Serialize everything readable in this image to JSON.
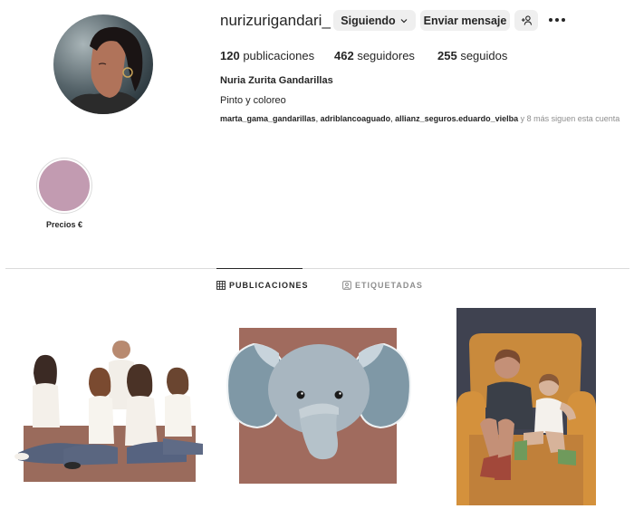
{
  "profile": {
    "username": "nurizurigandari_",
    "full_name": "Nuria Zurita Gandarillas",
    "bio": "Pinto y coloreo"
  },
  "actions": {
    "following_label": "Siguiendo",
    "message_label": "Enviar mensaje"
  },
  "stats": {
    "posts_count": "120",
    "posts_label": "publicaciones",
    "followers_count": "462",
    "followers_label": "seguidores",
    "following_count": "255",
    "following_label": "seguidos"
  },
  "followed_by": {
    "names": [
      "marta_gama_gandarillas",
      "adriblancoaguado",
      "allianz_seguros.eduardo_vielba"
    ],
    "separator": ", ",
    "more_text": " y 8 más siguen esta cuenta"
  },
  "highlights": [
    {
      "label": "Precios €",
      "color": "#c29bb1"
    }
  ],
  "tabs": [
    {
      "label": "PUBLICACIONES",
      "icon": "grid-icon",
      "active": true
    },
    {
      "label": "ETIQUETADAS",
      "icon": "tagged-icon",
      "active": false
    }
  ],
  "posts": [
    {
      "name": "family-illustration"
    },
    {
      "name": "elephant-illustration"
    },
    {
      "name": "children-armchair-illustration"
    }
  ],
  "colors": {
    "button_bg": "#efefef",
    "text": "#262626",
    "secondary_text": "#8e8e8e",
    "divider": "#dbdbdb"
  }
}
